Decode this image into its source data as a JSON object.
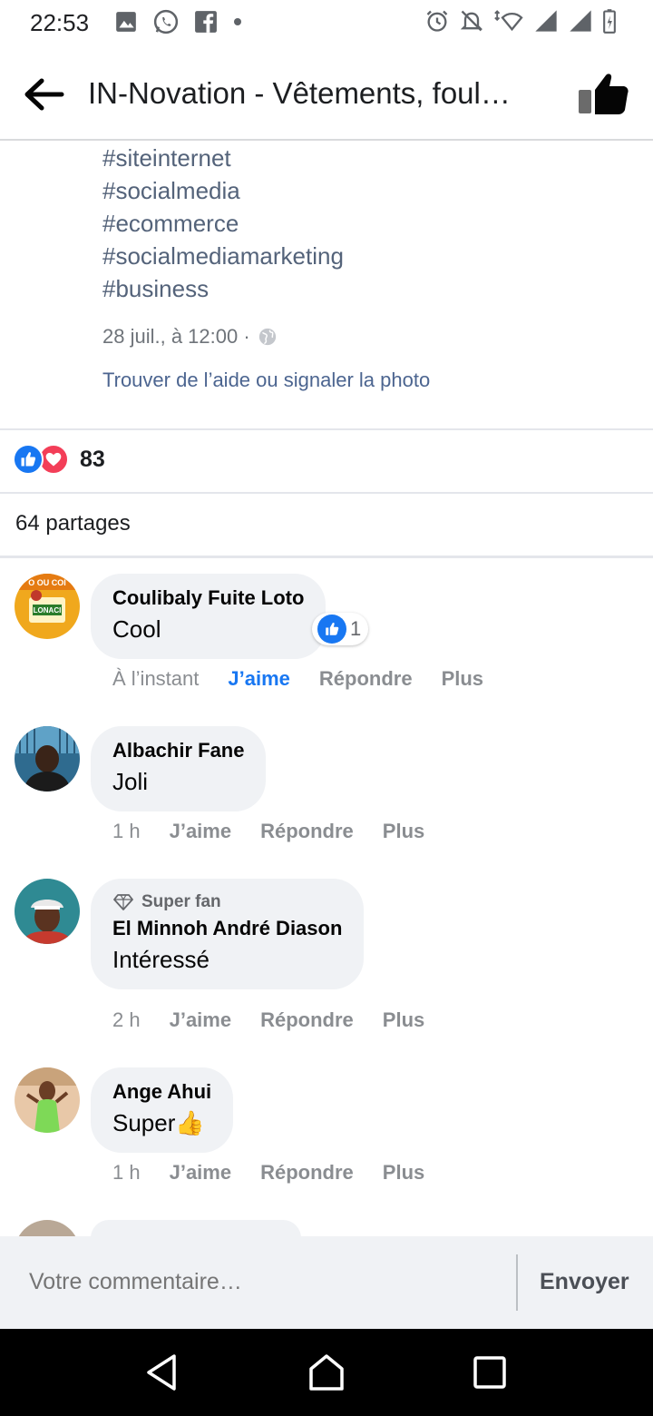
{
  "status_bar": {
    "time": "22:53",
    "left_icons": [
      "gallery-icon",
      "whatsapp-icon",
      "facebook-icon",
      "dot-icon"
    ],
    "right_icons": [
      "alarm-icon",
      "mute-icon",
      "wifi-icon",
      "signal-icon",
      "signal-icon",
      "battery-icon"
    ]
  },
  "header": {
    "title": "IN-Novation - Vêtements, foul…",
    "back_icon": "arrow-left-icon",
    "like_icon": "thumbs-up-icon"
  },
  "post": {
    "hashtags": [
      "#siteinternet",
      "#socialmedia",
      "#ecommerce",
      "#socialmediamarketing",
      "#business"
    ],
    "date": "28 juil., à 12:00 ·",
    "privacy_icon": "globe-icon",
    "help_link": "Trouver de l’aide ou signaler la photo"
  },
  "reactions": {
    "count": "83",
    "types": [
      "like",
      "love"
    ]
  },
  "shares": "64 partages",
  "comments": [
    {
      "author": "Coulibaly Fuite Loto",
      "text": "Cool",
      "time": "À l’instant",
      "like": "J’aime",
      "reply": "Répondre",
      "more": "Plus",
      "liked": true,
      "reaction_count": "1"
    },
    {
      "author": "Albachir Fane",
      "text": "Joli",
      "time": "1 h",
      "like": "J’aime",
      "reply": "Répondre",
      "more": "Plus"
    },
    {
      "badge": "Super fan",
      "author": "El Minnoh André Diason",
      "text": "Intéressé",
      "time": "2 h",
      "like": "J’aime",
      "reply": "Répondre",
      "more": "Plus"
    },
    {
      "author": "Ange Ahui",
      "text": "Super",
      "emoji": "👍",
      "time": "1 h",
      "like": "J’aime",
      "reply": "Répondre",
      "more": "Plus"
    }
  ],
  "composer": {
    "placeholder": "Votre commentaire…",
    "send_label": "Envoyer"
  },
  "nav": [
    "back-icon",
    "home-icon",
    "recents-icon"
  ],
  "colors": {
    "link_blue": "#1877f2",
    "hashtag": "#54637a",
    "bubble": "#f0f2f5",
    "love_red": "#f33e58"
  }
}
